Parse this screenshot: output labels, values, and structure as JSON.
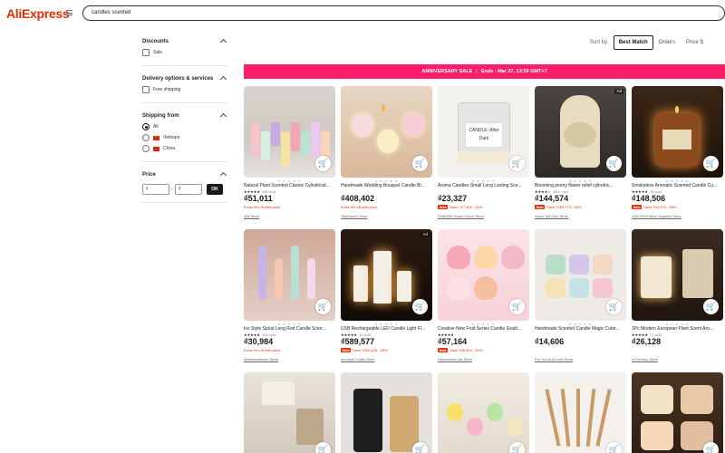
{
  "header": {
    "logo": "AliExpress",
    "search_value": "candles scented"
  },
  "sidebar": {
    "discounts": {
      "title": "Discounts",
      "options": [
        "Sale"
      ]
    },
    "delivery": {
      "title": "Delivery options & services",
      "options": [
        "Free shipping"
      ]
    },
    "shipping_from": {
      "title": "Shipping from",
      "options": [
        "All",
        "Vietnam",
        "China"
      ],
      "selected": "All"
    },
    "price": {
      "title": "Price",
      "min_placeholder": "₫",
      "max_placeholder": "₫",
      "ok_label": "OK"
    }
  },
  "sort": {
    "label": "Sort by:",
    "options": [
      "Best Match",
      "Orders",
      "Price"
    ],
    "active": "Best Match"
  },
  "banner": {
    "title": "ANNIVERSARY SALE",
    "ends": "Ends : Mar 27, 13:59 GMT+7"
  },
  "products": [
    {
      "title": "Natural Plant Scented Classic Cylindrical...",
      "rating": "★★★★★",
      "sold": "258 sold",
      "price": "₫51,011",
      "promo": "Extra 5% off with coins",
      "store": "Will Store",
      "ad": false
    },
    {
      "title": "Handmade Wedding Bouquet Candle Bi...",
      "rating": "",
      "sold": "",
      "price": "₫408,402",
      "promo": "Extra 5% off with coins",
      "store": "TidyHaven Store",
      "ad": false
    },
    {
      "title": "Aroma Candles Small Long Lasting Sce...",
      "rating": "",
      "sold": "",
      "price": "₫23,327",
      "sale_tag": "Sale",
      "promo": "Save ₫27,426 - 54%",
      "store": "FAMURE Home Decor Store",
      "ad": false
    },
    {
      "title": "Blooming peony flower relief cylindric...",
      "rating": "★★★★☆",
      "sold": "300+ sold",
      "price": "₫144,574",
      "sale_tag": "Sale",
      "promo": "Save ₫162,773 - 53%",
      "store": "Super Init Club Store",
      "ad": true
    },
    {
      "title": "Smokeless Aromatic Scented Candle Cu...",
      "rating": "★★★★★",
      "sold": "18 sold",
      "price": "₫148,506",
      "sale_tag": "Sale",
      "promo": "Save ₫94,975 - 39%",
      "store": "UNLYEN Home Supplies Store",
      "ad": false
    },
    {
      "title": "Ins Style Spiral Long Rod Candle Scen...",
      "rating": "★★★★★",
      "sold": "136 sold",
      "price": "₫30,984",
      "promo": "Extra 2% off with coins",
      "store": "Westmelastone Store",
      "ad": false
    },
    {
      "title": "USB Rechargeable LED Candle Light Fl...",
      "rating": "★★★★★",
      "sold": "31 sold",
      "price": "₫589,577",
      "sale_tag": "Sale",
      "promo": "Save ₫452,428 - 45%",
      "store": "sunnaye Crafts Store",
      "ad": true
    },
    {
      "title": "Creative New Fruit Series Candle Gradi...",
      "rating": "★★★★★",
      "sold": "",
      "price": "₫57,164",
      "sale_tag": "Sale",
      "promo": "Save ₫66,904 - 54%",
      "store": "Houseworm Art Store",
      "ad": false
    },
    {
      "title": "Handmade Scented Candle Magic Cube...",
      "rating": "",
      "sold": "",
      "price": "₫14,606",
      "promo": "",
      "store": "For You And Love Store",
      "ad": false
    },
    {
      "title": "1Pc Modern European Plant Scent Aro...",
      "rating": "★★★★★",
      "sold": "27 sold",
      "price": "₫26,128",
      "promo": "",
      "store": "eTuli shop Store",
      "ad": false
    },
    {
      "title": "",
      "rating": "",
      "sold": "",
      "price": "",
      "promo": "",
      "store": "",
      "ad": false
    },
    {
      "title": "",
      "rating": "",
      "sold": "",
      "price": "",
      "promo": "",
      "store": "",
      "ad": false
    },
    {
      "title": "",
      "rating": "",
      "sold": "",
      "price": "",
      "promo": "",
      "store": "",
      "ad": false
    },
    {
      "title": "",
      "rating": "",
      "sold": "",
      "price": "",
      "promo": "",
      "store": "",
      "ad": false
    },
    {
      "title": "",
      "rating": "",
      "sold": "",
      "price": "",
      "promo": "",
      "store": "",
      "ad": false
    }
  ],
  "product_images": {
    "p2": "CANDLE: After Dark"
  },
  "icons": {
    "cart": "add-to-cart-icon",
    "caret": "chevron-up-icon",
    "menu": "hamburger-icon"
  },
  "colors": {
    "brand": "#e62e04",
    "banner": "#fd1d6a"
  }
}
